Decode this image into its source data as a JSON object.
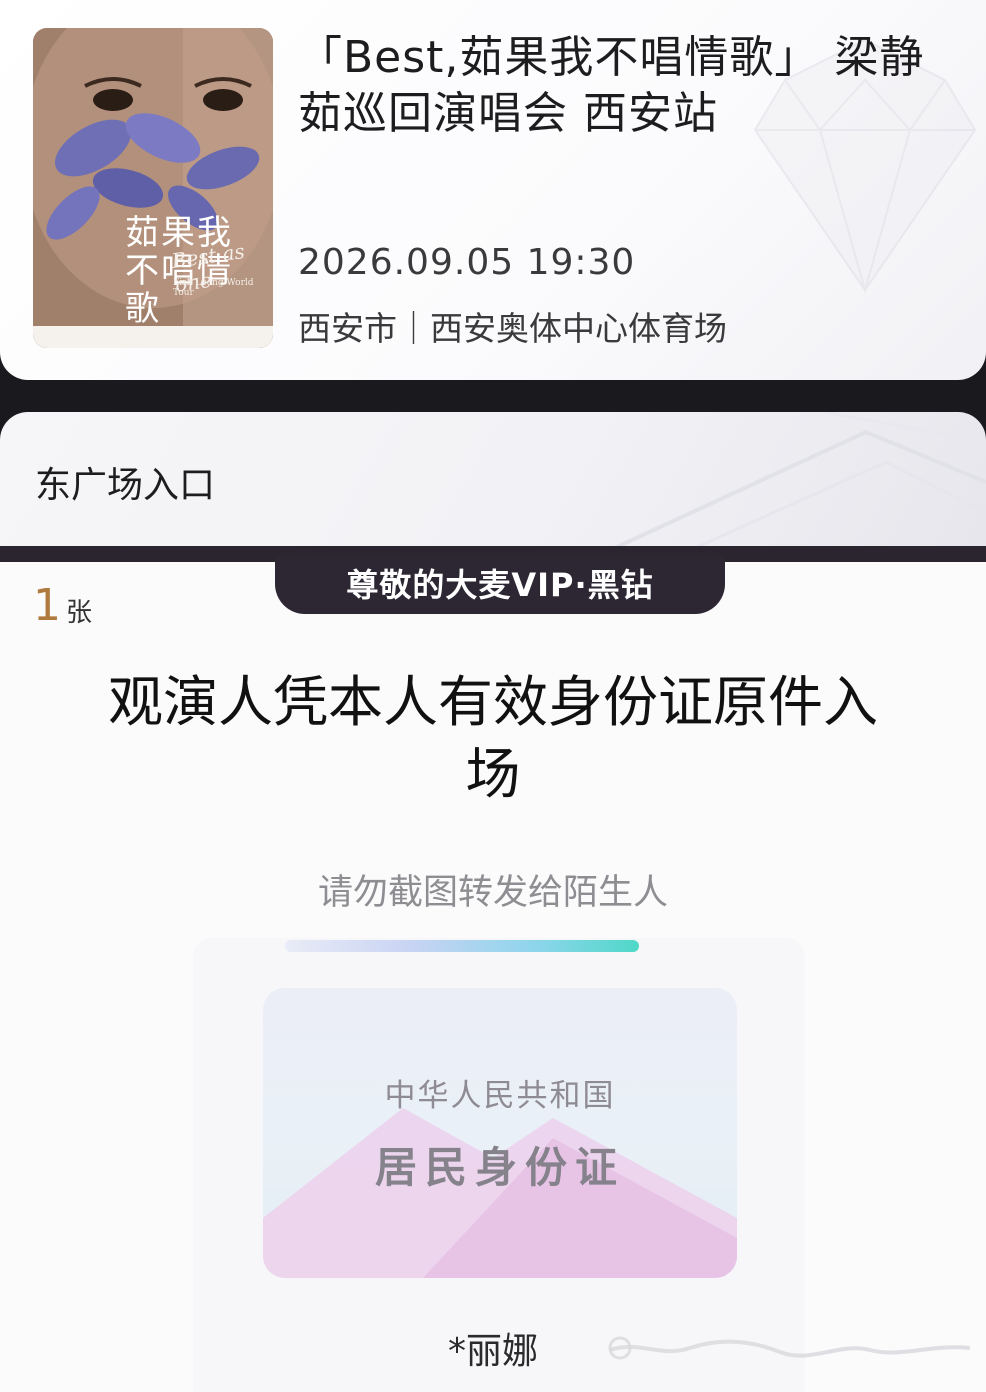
{
  "event": {
    "title": "「Best,茹果我不唱情歌」 梁静茹巡回演唱会 西安站",
    "datetime": "2026.09.05 19:30",
    "venue": "西安市｜西安奥体中心体育场"
  },
  "poster": {
    "title_chars": "茹果我不唱情歌",
    "script_text": "Best as one",
    "tour_text": "Fish Leong World Tour"
  },
  "entrance": {
    "label": "东广场入口"
  },
  "ticket": {
    "vip_badge": "尊敬的大麦VIP·黑钻",
    "quantity": "1",
    "quantity_unit": "张",
    "instruction": "观演人凭本人有效身份证原件入场",
    "warning": "请勿截图转发给陌生人",
    "id_card": {
      "country": "中华人民共和国",
      "type": "居民身份证"
    },
    "holder_name": "*丽娜"
  },
  "colors": {
    "quantity_accent": "#b07a3e",
    "badge_bg": "#2d2633",
    "page_bg": "#1a1a1e"
  }
}
